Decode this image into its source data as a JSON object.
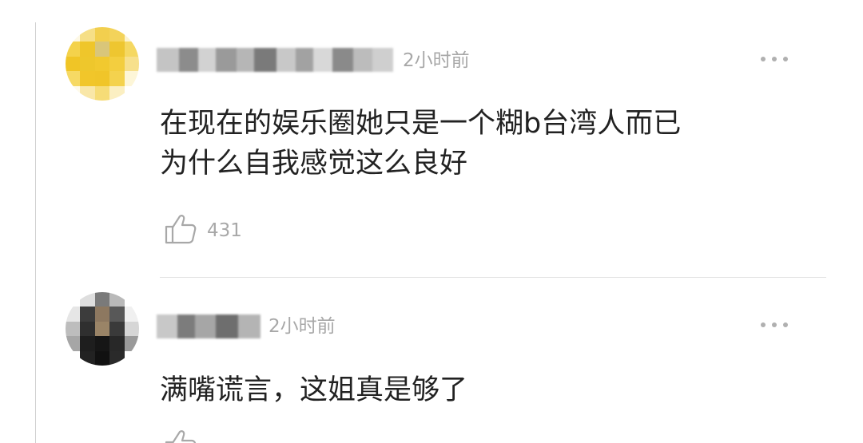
{
  "comments": [
    {
      "time": "2小时前",
      "text_line1": "在现在的娱乐圈她只是一个糊b台湾人而已",
      "text_line2": "为什么自我感觉这么良好",
      "likes": "431",
      "avatar_icon": "avatar-pixelated-yellow",
      "more_icon": "more-dots-icon",
      "like_icon": "thumbs-up-icon"
    },
    {
      "time": "2小时前",
      "text_line1": "满嘴谎言，这姐真是够了",
      "avatar_icon": "avatar-pixelated-dark",
      "more_icon": "more-dots-icon",
      "like_icon": "thumbs-up-icon"
    }
  ],
  "colors": {
    "text": "#222222",
    "meta": "#a8a8a8",
    "divider": "#e3e3e3",
    "avatar_yellow": "#f2c82e"
  }
}
